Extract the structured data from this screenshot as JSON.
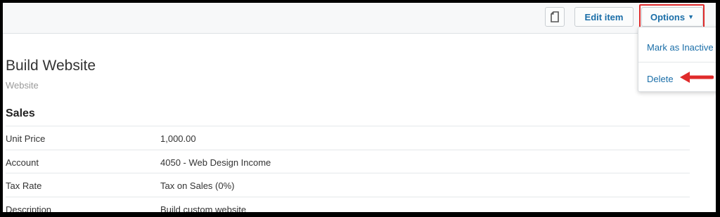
{
  "toolbar": {
    "edit_label": "Edit item",
    "options_label": "Options",
    "options_menu": [
      {
        "label": "Mark as Inactive"
      },
      {
        "label": "Delete"
      }
    ]
  },
  "item": {
    "name": "Build Website",
    "code": "Website"
  },
  "sales": {
    "heading": "Sales",
    "rows": [
      {
        "label": "Unit Price",
        "value": "1,000.00"
      },
      {
        "label": "Account",
        "value": "4050 - Web Design Income"
      },
      {
        "label": "Tax Rate",
        "value": "Tax on Sales (0%)"
      },
      {
        "label": "Description",
        "value": "Build custom website"
      }
    ]
  },
  "colors": {
    "link": "#1a6ea8",
    "highlight": "#e02b2b"
  }
}
